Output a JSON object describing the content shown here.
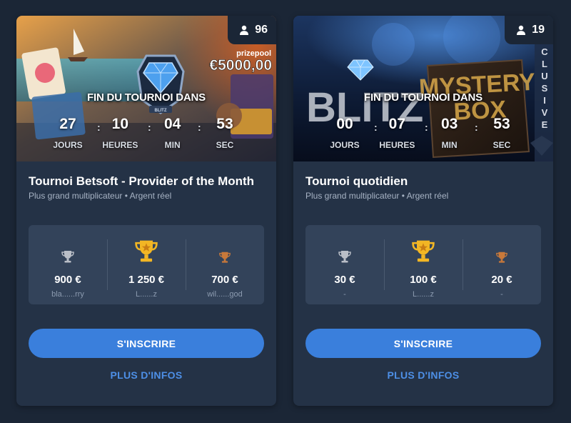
{
  "tournaments": [
    {
      "players": "96",
      "banner_title": "BLITZ",
      "prizepool_label": "prizepool",
      "prizepool_value": "€5000,00",
      "countdown_title": "FIN DU TOURNOI DANS",
      "countdown": {
        "days": "27",
        "days_label": "JOURS",
        "hours": "10",
        "hours_label": "HEURES",
        "mins": "04",
        "mins_label": "MIN",
        "secs": "53",
        "secs_label": "SEC"
      },
      "title": "Tournoi Betsoft - Provider of the Month",
      "subtitle": "Plus grand multiplicateur • Argent réel",
      "prizes": [
        {
          "rank": "2",
          "amount": "900 €",
          "winner": "bla......rry",
          "trophy_color": "#b9bec7"
        },
        {
          "rank": "1",
          "amount": "1 250 €",
          "winner": "L......z",
          "trophy_color": "#f2b624"
        },
        {
          "rank": "3",
          "amount": "700 €",
          "winner": "wil......god",
          "trophy_color": "#c9793a"
        }
      ],
      "register_label": "S'INSCRIRE",
      "more_label": "PLUS D'INFOS"
    },
    {
      "players": "19",
      "banner_title": "BLITZ",
      "banner_subtitle_1": "MYSTERY",
      "banner_subtitle_2": "BOX",
      "banner_vertical": "CLUSIVE",
      "countdown_title": "FIN DU TOURNOI DANS",
      "countdown": {
        "days": "00",
        "days_label": "JOURS",
        "hours": "07",
        "hours_label": "HEURES",
        "mins": "03",
        "mins_label": "MIN",
        "secs": "53",
        "secs_label": "SEC"
      },
      "title": "Tournoi quotidien",
      "subtitle": "Plus grand multiplicateur • Argent réel",
      "prizes": [
        {
          "rank": "2",
          "amount": "30 €",
          "winner": "-",
          "trophy_color": "#b9bec7"
        },
        {
          "rank": "1",
          "amount": "100 €",
          "winner": "L......z",
          "trophy_color": "#f2b624"
        },
        {
          "rank": "3",
          "amount": "20 €",
          "winner": "-",
          "trophy_color": "#c9793a"
        }
      ],
      "register_label": "S'INSCRIRE",
      "more_label": "PLUS D'INFOS"
    }
  ],
  "colors": {
    "page_bg": "#1b2636",
    "card_bg": "#243246",
    "prize_box_bg": "#33435a",
    "primary_button": "#3a7fdc",
    "link": "#4d8fe6"
  }
}
